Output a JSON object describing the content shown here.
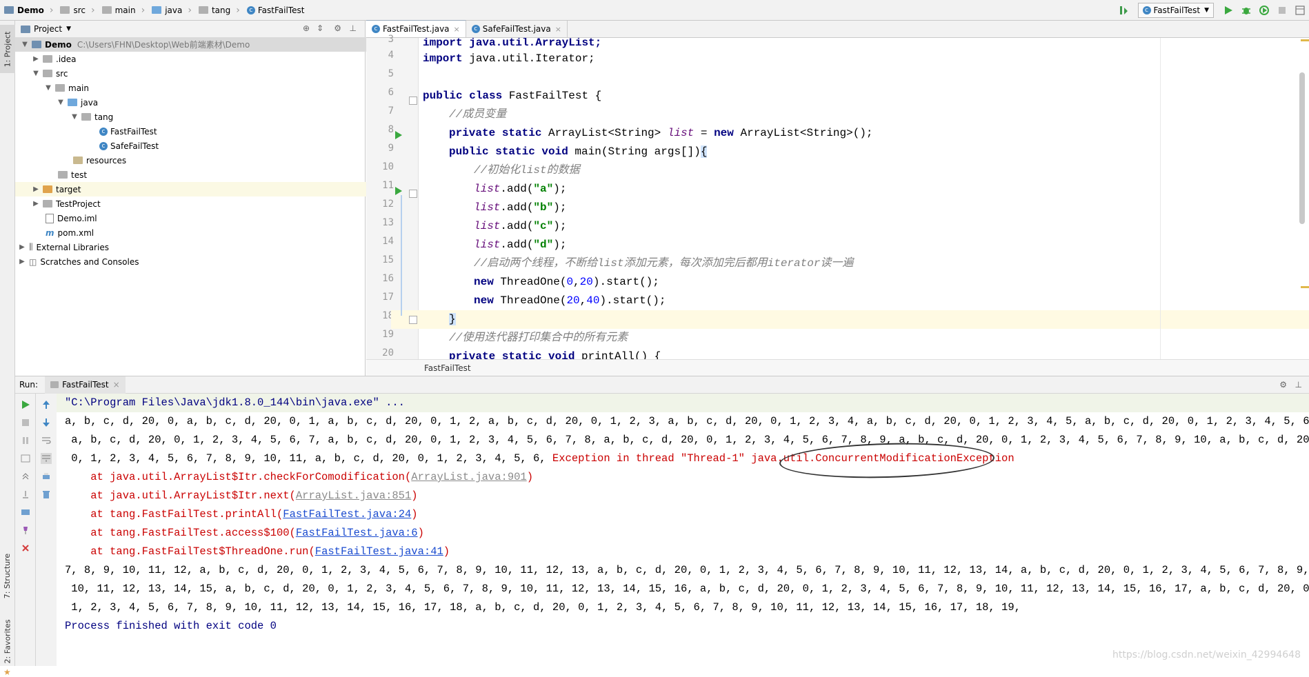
{
  "navbar": {
    "crumbs": [
      "Demo",
      "src",
      "main",
      "java",
      "tang",
      "FastFailTest"
    ],
    "run_config": "FastFailTest"
  },
  "leftstrip": {
    "project_tab": "1: Project",
    "structure_tab": "7: Structure",
    "favorites_tab": "2: Favorites"
  },
  "project": {
    "header_label": "Project",
    "root_name": "Demo",
    "root_path": "C:\\Users\\FHN\\Desktop\\Web前端素材\\Demo",
    "items": [
      {
        "label": ".idea"
      },
      {
        "label": "src"
      },
      {
        "label": "main"
      },
      {
        "label": "java"
      },
      {
        "label": "tang"
      },
      {
        "label": "FastFailTest"
      },
      {
        "label": "SafeFailTest"
      },
      {
        "label": "resources"
      },
      {
        "label": "test"
      },
      {
        "label": "target"
      },
      {
        "label": "TestProject"
      },
      {
        "label": "Demo.iml"
      },
      {
        "label": "pom.xml"
      },
      {
        "label": "External Libraries"
      },
      {
        "label": "Scratches and Consoles"
      }
    ]
  },
  "editor": {
    "tabs": [
      "FastFailTest.java",
      "SafeFailTest.java"
    ],
    "line_numbers": [
      "3",
      "4",
      "5",
      "6",
      "7",
      "8",
      "9",
      "10",
      "11",
      "12",
      "13",
      "14",
      "15",
      "16",
      "17",
      "18",
      "19",
      "20"
    ],
    "breadcrumb": "FastFailTest"
  },
  "code": {
    "l3": "import java.util.ArrayList;",
    "l4a": "import",
    "l4b": " java.util.Iterator;",
    "l6a": "public class",
    "l6b": " FastFailTest {",
    "l7": "//成员变量",
    "l8a": "private static",
    "l8b": " ArrayList<String> ",
    "l8c": "list",
    "l8d": " = ",
    "l8e": "new",
    "l8f": " ArrayList<String>();",
    "l9a": "public static void",
    "l9b": " main(String args[])",
    "l9c": "{",
    "l10": "//初始化list的数据",
    "adds": [
      {
        "field": "list",
        "mid": ".add(",
        "arg": "\"a\"",
        "end": ");"
      },
      {
        "field": "list",
        "mid": ".add(",
        "arg": "\"b\"",
        "end": ");"
      },
      {
        "field": "list",
        "mid": ".add(",
        "arg": "\"c\"",
        "end": ");"
      },
      {
        "field": "list",
        "mid": ".add(",
        "arg": "\"d\"",
        "end": ");"
      }
    ],
    "l15": "//启动两个线程，不断给list添加元素，每次添加完后都用iterator读一遍",
    "l16a": "new",
    "l16b": " ThreadOne(",
    "l16c": "0",
    "l16d": ",",
    "l16e": "20",
    "l16f": ").start();",
    "l17a": "new",
    "l17b": " ThreadOne(",
    "l17c": "20",
    "l17d": ",",
    "l17e": "40",
    "l17f": ").start();",
    "l18": "}",
    "l19": "//使用迭代器打印集合中的所有元素",
    "l20a": "private static void",
    "l20b": " printAll() {"
  },
  "run": {
    "label": "Run:",
    "tab": "FastFailTest"
  },
  "console": {
    "cmd": "\"C:\\Program Files\\Java\\jdk1.8.0_144\\bin\\java.exe\" ...",
    "out1": "a, b, c, d, 20, 0, a, b, c, d, 20, 0, 1, a, b, c, d, 20, 0, 1, 2, a, b, c, d, 20, 0, 1, 2, 3, a, b, c, d, 20, 0, 1, 2, 3, 4, a, b, c, d, 20, 0, 1, 2, 3, 4, 5, a, b, c, d, 20, 0, 1, 2, 3, 4, 5, 6,",
    "out2": " a, b, c, d, 20, 0, 1, 2, 3, 4, 5, 6, 7, a, b, c, d, 20, 0, 1, 2, 3, 4, 5, 6, 7, 8, a, b, c, d, 20, 0, 1, 2, 3, 4, 5, 6, 7, 8, 9, a, b, c, d, 20, 0, 1, 2, 3, 4, 5, 6, 7, 8, 9, 10, a, b, c, d, 20,",
    "out3a": " 0, 1, 2, 3, 4, 5, 6, 7, 8, 9, 10, 11, a, b, c, d, 20, 0, 1, 2, 3, 4, 5, 6, ",
    "out3b": "Exception in thread \"Thread-1\" java.util.ConcurrentModificationException",
    "stack": [
      {
        "pre": "    at java.util.ArrayList$Itr.checkForComodification(",
        "link": "ArrayList.java:901",
        "post": ")",
        "lib": true
      },
      {
        "pre": "    at java.util.ArrayList$Itr.next(",
        "link": "ArrayList.java:851",
        "post": ")",
        "lib": true
      },
      {
        "pre": "    at tang.FastFailTest.printAll(",
        "link": "FastFailTest.java:24",
        "post": ")",
        "lib": false
      },
      {
        "pre": "    at tang.FastFailTest.access$100(",
        "link": "FastFailTest.java:6",
        "post": ")",
        "lib": false
      },
      {
        "pre": "    at tang.FastFailTest$ThreadOne.run(",
        "link": "FastFailTest.java:41",
        "post": ")",
        "lib": false
      }
    ],
    "out4": "7, 8, 9, 10, 11, 12, a, b, c, d, 20, 0, 1, 2, 3, 4, 5, 6, 7, 8, 9, 10, 11, 12, 13, a, b, c, d, 20, 0, 1, 2, 3, 4, 5, 6, 7, 8, 9, 10, 11, 12, 13, 14, a, b, c, d, 20, 0, 1, 2, 3, 4, 5, 6, 7, 8, 9,",
    "out5": " 10, 11, 12, 13, 14, 15, a, b, c, d, 20, 0, 1, 2, 3, 4, 5, 6, 7, 8, 9, 10, 11, 12, 13, 14, 15, 16, a, b, c, d, 20, 0, 1, 2, 3, 4, 5, 6, 7, 8, 9, 10, 11, 12, 13, 14, 15, 16, 17, a, b, c, d, 20, 0,",
    "out6": " 1, 2, 3, 4, 5, 6, 7, 8, 9, 10, 11, 12, 13, 14, 15, 16, 17, 18, a, b, c, d, 20, 0, 1, 2, 3, 4, 5, 6, 7, 8, 9, 10, 11, 12, 13, 14, 15, 16, 17, 18, 19,",
    "finished": "Process finished with exit code 0"
  },
  "watermark": "https://blog.csdn.net/weixin_42994648"
}
